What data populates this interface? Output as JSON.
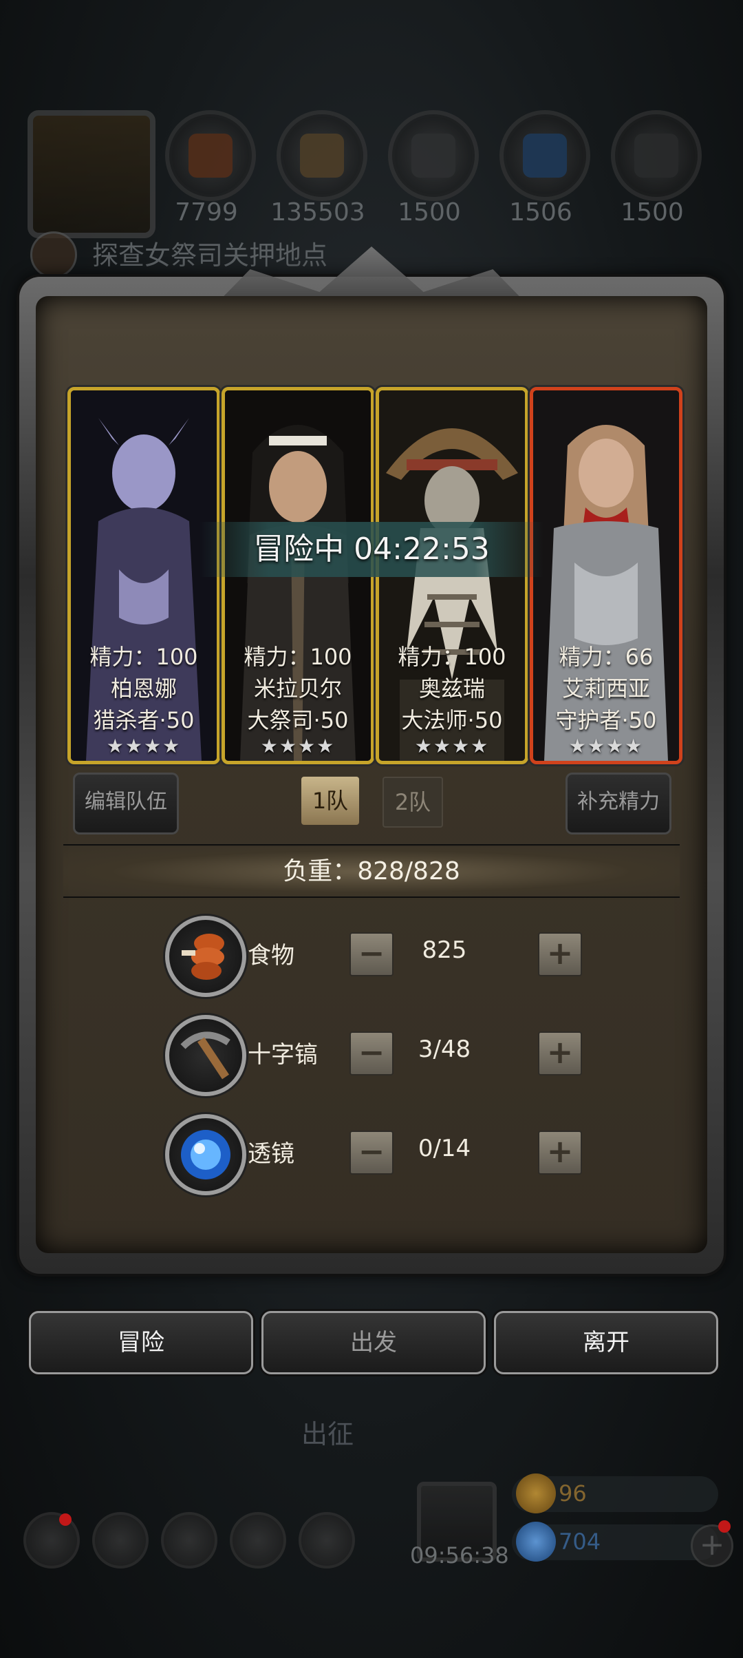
{
  "background": {
    "resources": [
      {
        "icon": "meat-icon",
        "color": "#b5501f",
        "value": "7799"
      },
      {
        "icon": "wood-icon",
        "color": "#a97a3e",
        "value": "135503"
      },
      {
        "icon": "iron-icon",
        "color": "#5a5a5a",
        "value": "1500"
      },
      {
        "icon": "crystal-icon",
        "color": "#2f73c9",
        "value": "1506"
      },
      {
        "icon": "stone-icon",
        "color": "#4c4c4c",
        "value": "1500"
      }
    ],
    "quest_text": "探查女祭司关押地点",
    "section_label": "出征",
    "bottom_timer": "09:56:38",
    "gold": "96",
    "gems": "704"
  },
  "modal": {
    "status_banner": "冒险中 04:22:53",
    "heroes": [
      {
        "energy": "精力：100",
        "name": "柏恩娜",
        "role": "猎杀者·50",
        "stars": "★★★★",
        "border": "gold",
        "skin": "#9a97c7"
      },
      {
        "energy": "精力：100",
        "name": "米拉贝尔",
        "role": "大祭司·50",
        "stars": "★★★★",
        "border": "gold",
        "skin": "#c29c7d"
      },
      {
        "energy": "精力：100",
        "name": "奥兹瑞",
        "role": "大法师·50",
        "stars": "★★★★",
        "border": "gold",
        "skin": "#a59f92"
      },
      {
        "energy": "精力：66",
        "name": "艾莉西亚",
        "role": "守护者·50",
        "stars": "★★★★",
        "border": "red",
        "skin": "#d2ad93"
      }
    ],
    "edit_team_label": "编辑队伍",
    "team_tabs": [
      "1队",
      "2队"
    ],
    "refill_energy_label": "补充精力",
    "load": "负重：828/828",
    "items": [
      {
        "icon": "food-icon",
        "label": "食物",
        "value": "825"
      },
      {
        "icon": "pickaxe-icon",
        "label": "十字镐",
        "value": "3/48"
      },
      {
        "icon": "lens-icon",
        "label": "透镜",
        "value": "0/14"
      }
    ],
    "stepper_minus": "−",
    "stepper_plus": "+",
    "actions": [
      "冒险",
      "出发",
      "离开"
    ]
  }
}
